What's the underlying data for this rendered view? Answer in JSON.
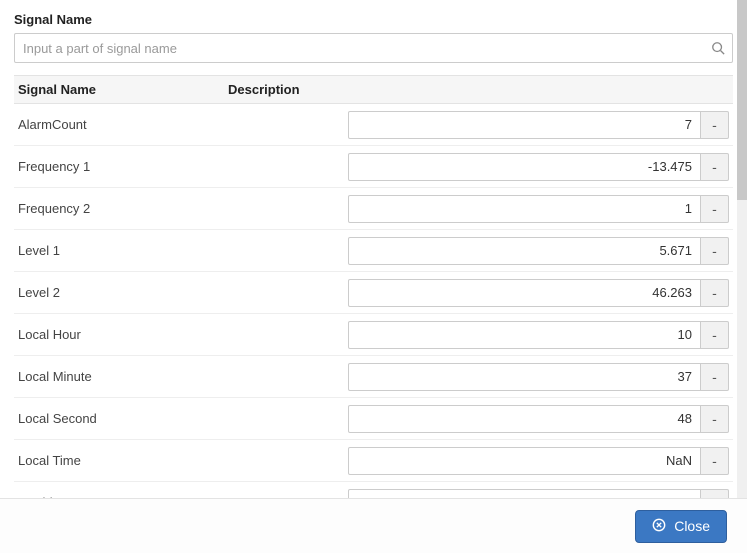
{
  "header": {
    "section_label": "Signal Name"
  },
  "search": {
    "placeholder": "Input a part of signal name",
    "value": ""
  },
  "table": {
    "columns": {
      "name": "Signal Name",
      "description": "Description"
    },
    "rows": [
      {
        "name": "AlarmCount",
        "value": "7",
        "btn": "-"
      },
      {
        "name": "Frequency 1",
        "value": "-13.475",
        "btn": "-"
      },
      {
        "name": "Frequency 2",
        "value": "1",
        "btn": "-"
      },
      {
        "name": "Level 1",
        "value": "5.671",
        "btn": "-"
      },
      {
        "name": "Level 2",
        "value": "46.263",
        "btn": "-"
      },
      {
        "name": "Local Hour",
        "value": "10",
        "btn": "-"
      },
      {
        "name": "Local Minute",
        "value": "37",
        "btn": "-"
      },
      {
        "name": "Local Second",
        "value": "48",
        "btn": "-"
      },
      {
        "name": "Local Time",
        "value": "NaN",
        "btn": "-"
      },
      {
        "name": "MachineOP",
        "value": "",
        "btn": "-"
      }
    ]
  },
  "footer": {
    "close_label": "Close"
  },
  "colors": {
    "primary": "#3b78c3"
  }
}
